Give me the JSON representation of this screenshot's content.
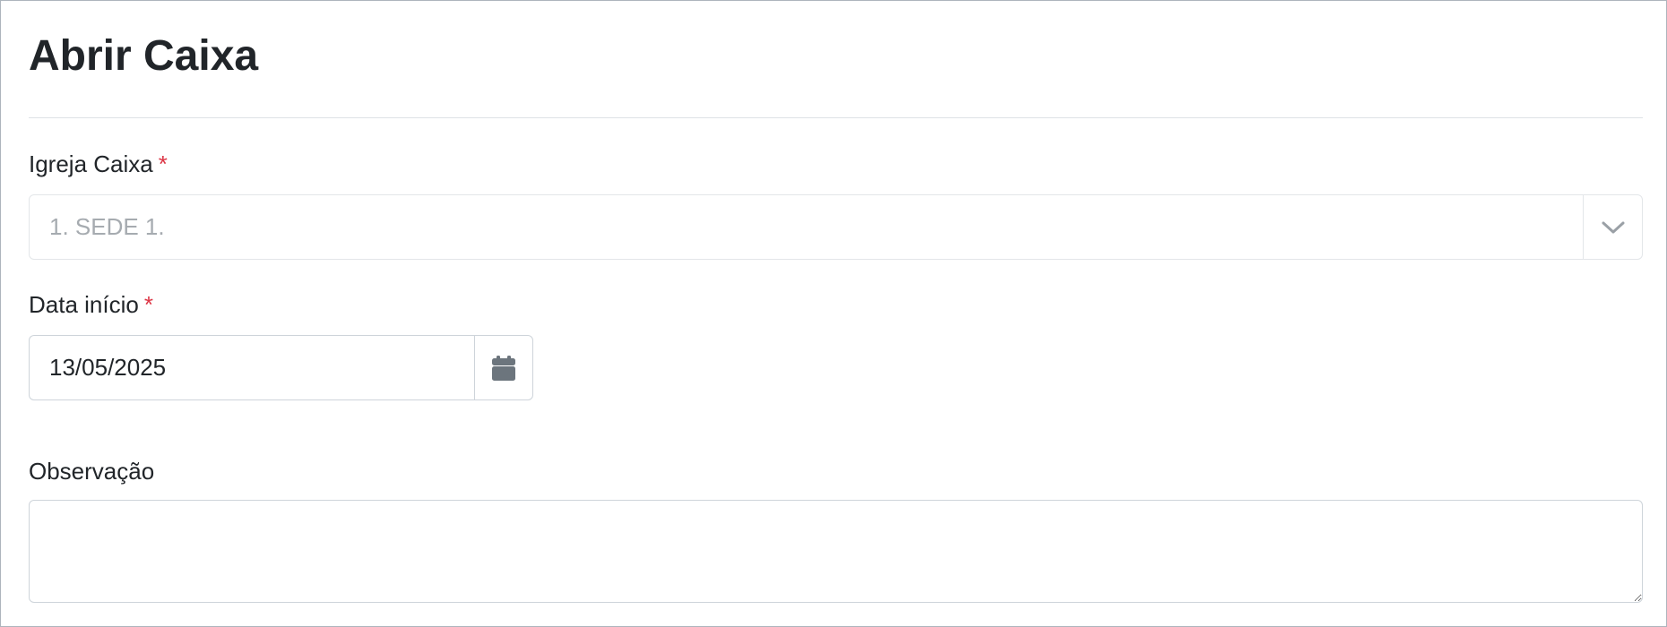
{
  "page": {
    "title": "Abrir Caixa"
  },
  "form": {
    "igreja_caixa": {
      "label": "Igreja Caixa",
      "required_mark": "*",
      "selected_value": "1. SEDE 1."
    },
    "data_inicio": {
      "label": "Data início",
      "required_mark": "*",
      "value": "13/05/2025"
    },
    "observacao": {
      "label": "Observação",
      "value": ""
    }
  },
  "icons": {
    "select_arrow": "chevron-down-icon",
    "date_picker": "calendar-icon"
  },
  "colors": {
    "required": "#dc3545",
    "text": "#212529",
    "placeholder": "#a6abb0",
    "border": "#ced4da",
    "icon": "#6c757d"
  }
}
